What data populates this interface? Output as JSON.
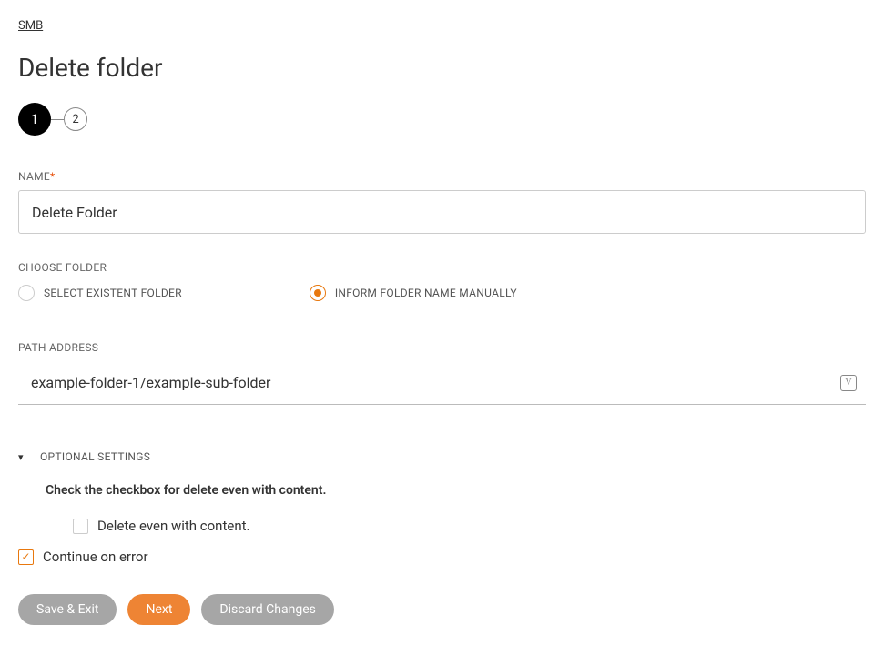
{
  "breadcrumb": "SMB",
  "pageTitle": "Delete folder",
  "stepper": {
    "step1": "1",
    "step2": "2"
  },
  "nameField": {
    "label": "NAME",
    "value": "Delete Folder"
  },
  "chooseFolder": {
    "label": "CHOOSE FOLDER",
    "option1": "SELECT EXISTENT FOLDER",
    "option2": "INFORM FOLDER NAME MANUALLY"
  },
  "pathField": {
    "label": "PATH ADDRESS",
    "value": "example-folder-1/example-sub-folder",
    "suffixGlyph": "V"
  },
  "optional": {
    "header": "OPTIONAL SETTINGS",
    "helpText": "Check the checkbox for delete even with content.",
    "deleteEvenLabel": "Delete even with content.",
    "continueOnErrorLabel": "Continue on error"
  },
  "buttons": {
    "saveExit": "Save & Exit",
    "next": "Next",
    "discard": "Discard Changes"
  }
}
